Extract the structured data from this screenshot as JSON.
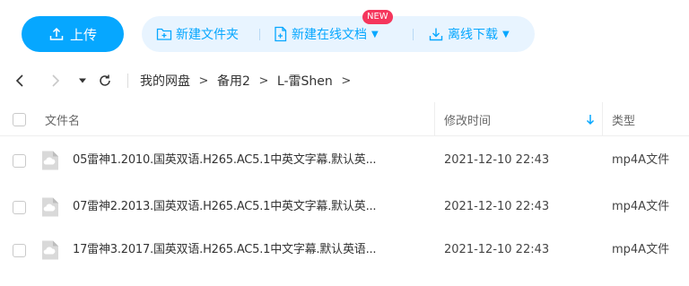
{
  "colors": {
    "accent": "#06a7ff",
    "action_bar_bg": "#e8f4ff",
    "badge_new": "#f5365c"
  },
  "toolbar": {
    "upload_label": "上传",
    "upload_icon": "upload-icon",
    "new_folder_label": "新建文件夹",
    "new_folder_icon": "folder-plus-icon",
    "new_online_doc_label": "新建在线文档",
    "new_online_doc_icon": "doc-plus-icon",
    "new_badge": "NEW",
    "offline_download_label": "离线下载",
    "offline_download_icon": "download-icon"
  },
  "breadcrumb": {
    "items": [
      "我的网盘",
      "备用2",
      "L-雷Shen"
    ],
    "separator": ">"
  },
  "table": {
    "headers": {
      "name": "文件名",
      "time": "修改时间",
      "type": "类型"
    },
    "sort_column": "time",
    "rows": [
      {
        "name": "05雷神1.2010.国英双语.H265.AC5.1中英文字幕.默认英...",
        "time": "2021-12-10 22:43",
        "type": "mp4A文件"
      },
      {
        "name": "07雷神2.2013.国英双语.H265.AC5.1中英文字幕.默认英...",
        "time": "2021-12-10 22:43",
        "type": "mp4A文件"
      },
      {
        "name": "17雷神3.2017.国英双语.H265.AC5.1中文字幕.默认英语...",
        "time": "2021-12-10 22:43",
        "type": "mp4A文件"
      }
    ]
  }
}
